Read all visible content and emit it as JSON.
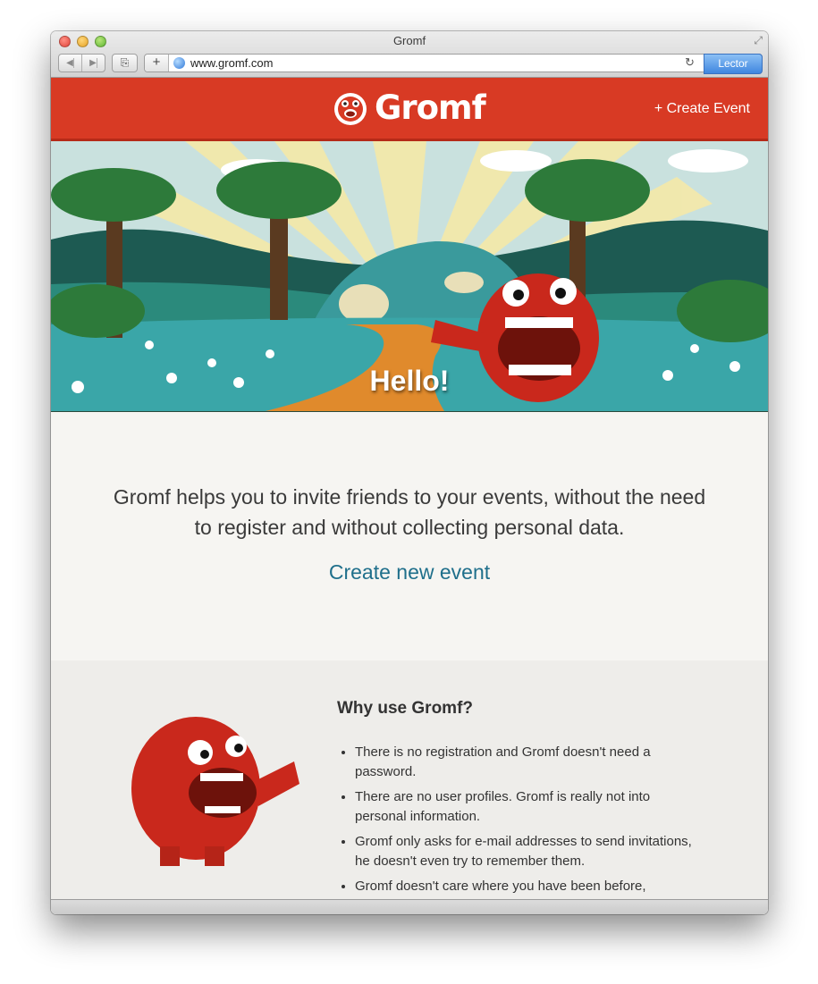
{
  "window": {
    "title": "Gromf"
  },
  "toolbar": {
    "back_icon": "back-arrow-icon",
    "forward_icon": "forward-arrow-icon",
    "share_icon": "share-icon",
    "add_glyph": "+",
    "url": "www.gromf.com",
    "reload_glyph": "↻",
    "lector_label": "Lector"
  },
  "header": {
    "logo_text": "Gromf",
    "create_event_label": "+ Create Event",
    "brand_color": "#d83a24"
  },
  "hero": {
    "greeting": "Hello!"
  },
  "intro": {
    "text": "Gromf helps you to invite friends to your events, without the need to register and without collecting personal data.",
    "cta_label": "Create new event",
    "link_color": "#1f6f8b"
  },
  "why": {
    "title": "Why use Gromf?",
    "items": [
      "There is no registration and Gromf doesn't need a password.",
      "There are no user profiles. Gromf is really not into personal information.",
      "Gromf only asks for e-mail addresses to send invitations, he doesn't even try to remember them.",
      "Gromf doesn't care where you have been before,"
    ]
  }
}
